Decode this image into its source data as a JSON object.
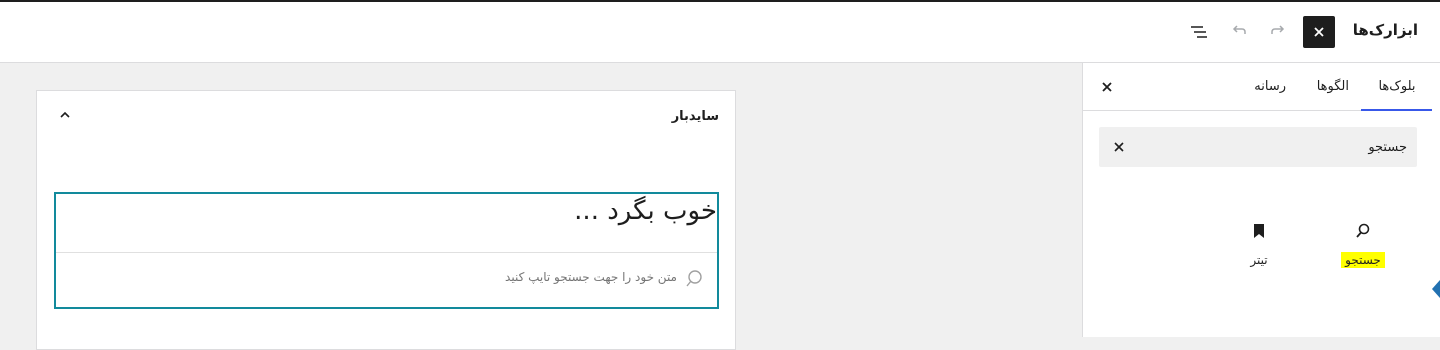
{
  "header": {
    "title": "ابزارک‌ها",
    "close_icon": "close-icon",
    "redo_icon": "redo-icon",
    "undo_icon": "undo-icon",
    "list_view_icon": "list-view-icon"
  },
  "inserter": {
    "tabs": [
      {
        "label": "بلوک‌ها",
        "active": true
      },
      {
        "label": "الگوها",
        "active": false
      },
      {
        "label": "رسانه",
        "active": false
      }
    ],
    "search": {
      "value": "جستجو"
    },
    "blocks": [
      {
        "label": "جستجو",
        "icon": "search-icon",
        "highlighted": true
      },
      {
        "label": "تیتر",
        "icon": "bookmark-icon",
        "highlighted": false
      }
    ],
    "accent_color": "#3858e9"
  },
  "canvas": {
    "area_title": "سایدبار",
    "widget": {
      "title": "خوب بگرد ...",
      "search_placeholder": "متن خود را جهت جستجو تایپ کنید"
    },
    "selection_color": "#128a9c"
  }
}
